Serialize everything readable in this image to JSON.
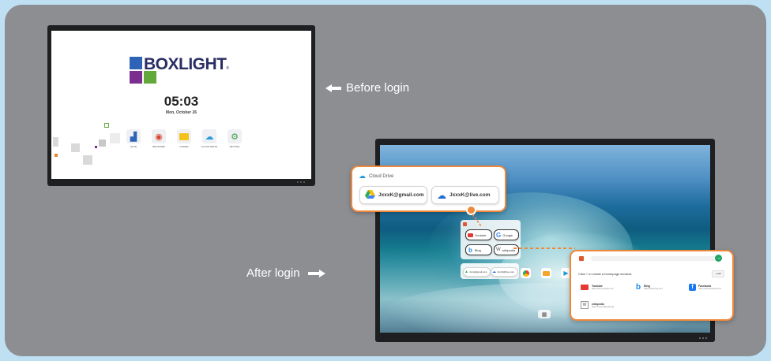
{
  "before": {
    "label": "Before login",
    "brand": "BOXLIGHT",
    "registered_mark": "®",
    "time": "05:03",
    "date": "Mon, October 26",
    "apps": [
      {
        "label": "NOTE",
        "icon": "note-icon"
      },
      {
        "label": "BROWSER",
        "icon": "browser-icon"
      },
      {
        "label": "FINDER",
        "icon": "folder-icon"
      },
      {
        "label": "CLOUD DRIVE",
        "icon": "cloud-icon"
      },
      {
        "label": "SETTING",
        "icon": "settings-icon"
      }
    ]
  },
  "after": {
    "label": "After login",
    "cloud_drive": {
      "title": "Cloud Drive",
      "accounts": [
        "JxxxK@gmail.com",
        "JxxxK@live.com"
      ]
    },
    "browser_popup": {
      "tiles": [
        "Youtube",
        "Google",
        "Bing",
        "wikipedia"
      ],
      "accounts": [
        "Jxxx@gmail.com",
        "JxxxK@live.com"
      ]
    },
    "homepage_card": {
      "prompt": "Click + to create a homepage shortcut",
      "add_label": "+ add",
      "shortcuts": [
        {
          "name": "Youtube",
          "url": "https://www.youtube.com"
        },
        {
          "name": "Bing",
          "url": "https://www.bing.com"
        },
        {
          "name": "Facebook",
          "url": "https://www.facebook.com"
        },
        {
          "name": "wikipedia",
          "url": "https://www.wikipedia.org"
        }
      ]
    },
    "apps_button_icon": "grid-icon"
  },
  "colors": {
    "background": "#bfe0f3",
    "panel": "#8c8e92",
    "accent_orange": "#f0883a",
    "brand_navy": "#2a2e63"
  }
}
